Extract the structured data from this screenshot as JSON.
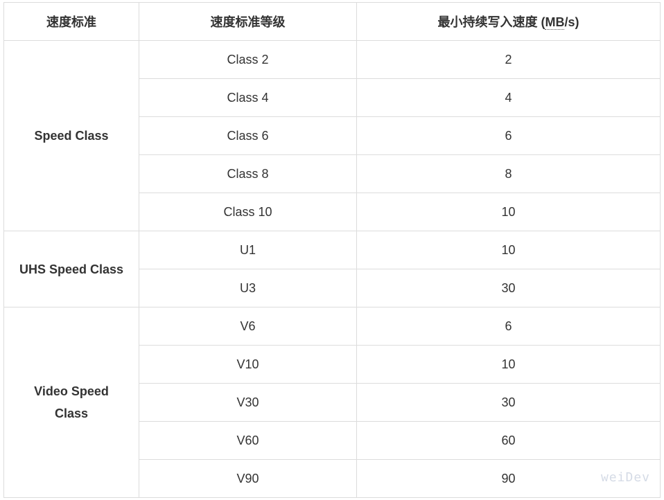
{
  "headers": [
    "速度标准",
    "速度标准等级"
  ],
  "header3": {
    "prefix": "最小持续写入速度 (",
    "unit": "MB",
    "suffix": "/s)"
  },
  "groups": [
    {
      "name": "Speed Class",
      "rows": [
        [
          "Class 2",
          "2"
        ],
        [
          "Class 4",
          "4"
        ],
        [
          "Class 6",
          "6"
        ],
        [
          "Class 8",
          "8"
        ],
        [
          "Class 10",
          "10"
        ]
      ]
    },
    {
      "name": "UHS Speed Class",
      "rows": [
        [
          "U1",
          "10"
        ],
        [
          "U3",
          "30"
        ]
      ]
    },
    {
      "name": "Video Speed Class",
      "rows": [
        [
          "V6",
          "6"
        ],
        [
          "V10",
          "10"
        ],
        [
          "V30",
          "30"
        ],
        [
          "V60",
          "60"
        ],
        [
          "V90",
          "90"
        ]
      ]
    }
  ],
  "watermark": "weiDev"
}
